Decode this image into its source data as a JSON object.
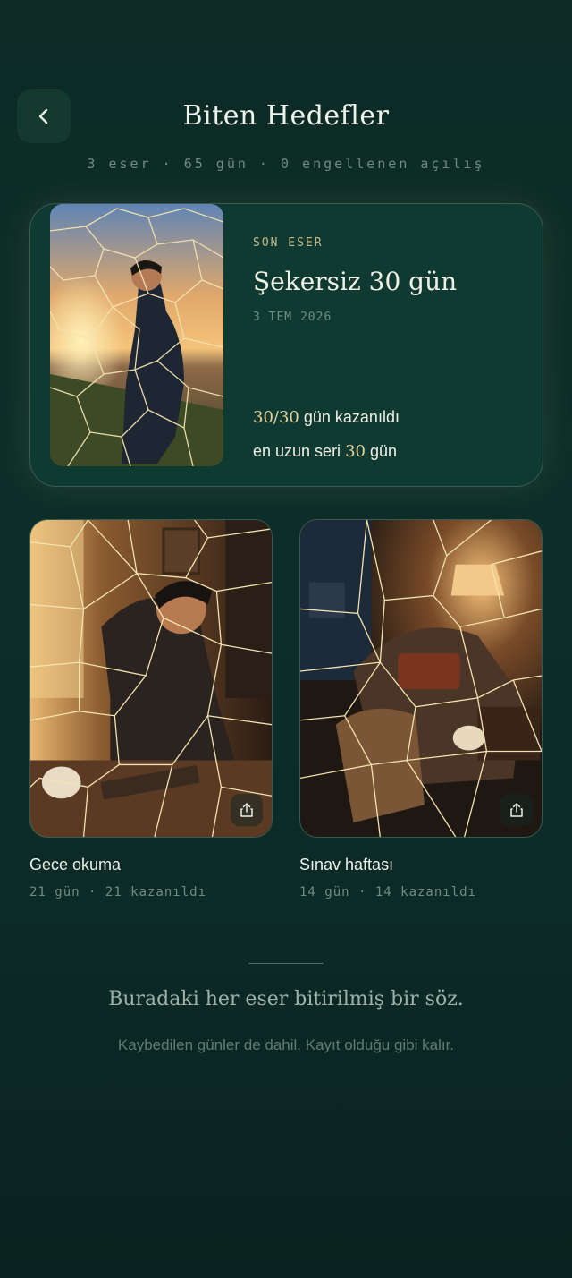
{
  "header": {
    "title": "Biten Hedefler",
    "stats": "3 eser · 65 gün · 0 engellenen açılış"
  },
  "hero": {
    "kicker": "SON ESER",
    "title": "Şekersiz 30 gün",
    "date": "3 TEM 2026",
    "won_value": "30/30",
    "won_label": " gün kazanıldı",
    "streak_prefix": "en uzun seri ",
    "streak_value": "30",
    "streak_suffix": " gün"
  },
  "cards": [
    {
      "title": "Gece okuma",
      "meta": "21 gün · 21 kazanıldı"
    },
    {
      "title": "Sınav haftası",
      "meta": "14 gün · 14 kazanıldı"
    }
  ],
  "footer": {
    "quote": "Buradaki her eser bitirilmiş bir söz.",
    "note": "Kaybedilen günler de dahil. Kayıt olduğu gibi kalır."
  },
  "colors": {
    "background": "#0d2f29",
    "accent_gold": "#e3d29b",
    "muted": "#6f8c83"
  },
  "icons": {
    "back": "chevron-left-icon",
    "share": "share-icon"
  }
}
